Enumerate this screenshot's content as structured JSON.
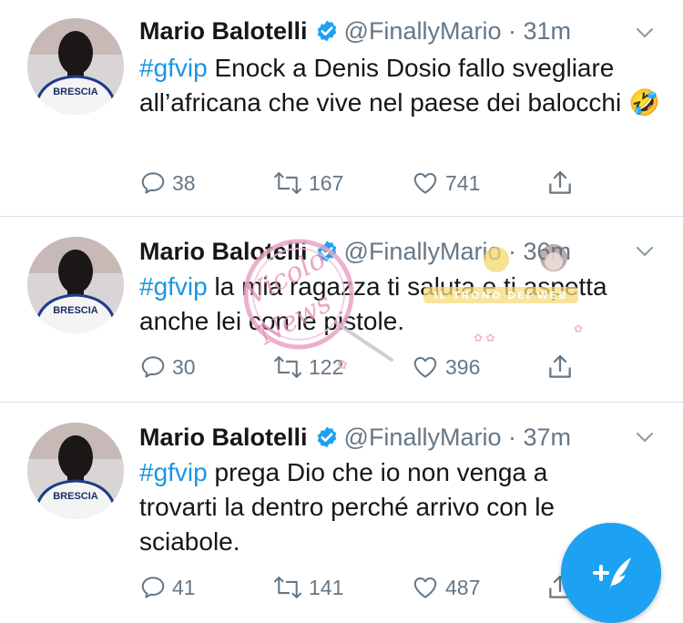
{
  "colors": {
    "accent": "#1da1f2",
    "hashtag": "#1b95e0",
    "muted": "#657786",
    "text": "#14171a",
    "verified": "#1da1f2"
  },
  "tweets": [
    {
      "name": "Mario Balotelli",
      "handle": "@FinallyMario",
      "dot": "·",
      "time": "31m",
      "hashtag": "#gfvip",
      "text": " Enock a Denis Dosio fallo svegliare all’africana che vive nel paese dei balocchi 🤣",
      "jersey": "BRESCIA",
      "replies": "38",
      "retweets": "167",
      "likes": "741"
    },
    {
      "name": "Mario Balotelli",
      "handle": "@FinallyMario",
      "dot": "·",
      "time": "36m",
      "hashtag": "#gfvip",
      "text": " la mia ragazza ti saluta e ti aspetta anche lei con le pistole.",
      "jersey": "BRESCIA",
      "replies": "30",
      "retweets": "122",
      "likes": "396"
    },
    {
      "name": "Mario Balotelli",
      "handle": "@FinallyMario",
      "dot": "·",
      "time": "37m",
      "hashtag": "#gfvip",
      "text": " prega Dio che io non venga a trovarti la dentro perché arrivo con le sciabole.",
      "jersey": "BRESCIA",
      "replies": "41",
      "retweets": "141",
      "likes": "487"
    }
  ],
  "watermark": {
    "text": "Vicolo delle News",
    "banner": "IL TRONO DEI WEB"
  },
  "icons": [
    "reply-icon",
    "retweet-icon",
    "like-icon",
    "share-icon",
    "chevron-down-icon",
    "verified-icon",
    "compose-tweet-icon"
  ]
}
